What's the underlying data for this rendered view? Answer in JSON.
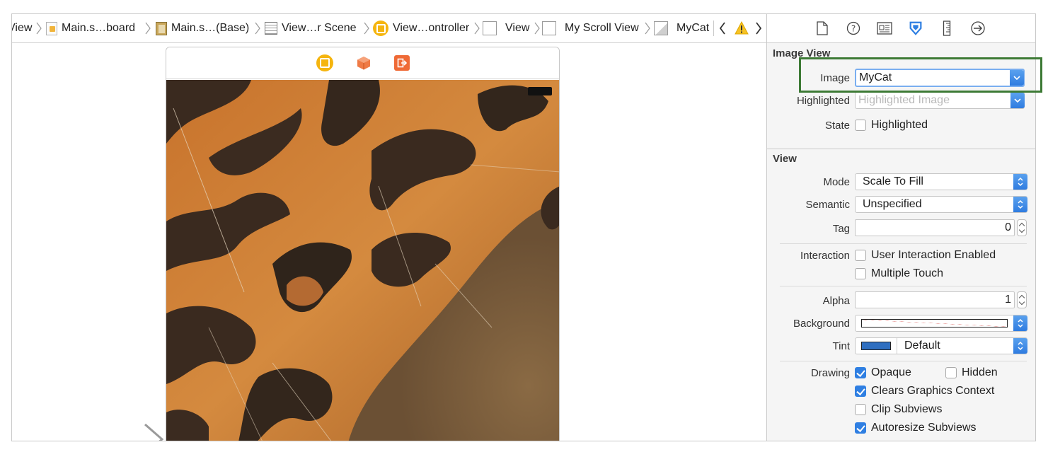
{
  "breadcrumbs": {
    "items": [
      {
        "label": "View",
        "icon": "none"
      },
      {
        "label": "Main.s…board",
        "icon": "storyboard-file-icon"
      },
      {
        "label": "Main.s…(Base)",
        "icon": "base-localization-icon"
      },
      {
        "label": "View…r Scene",
        "icon": "scene-icon"
      },
      {
        "label": "View…ontroller",
        "icon": "view-controller-icon"
      },
      {
        "label": "View",
        "icon": "view-icon"
      },
      {
        "label": "My Scroll View",
        "icon": "scroll-view-icon"
      },
      {
        "label": "MyCat",
        "icon": "image-view-icon"
      }
    ],
    "warning_icon": "warning-icon"
  },
  "inspector": {
    "tabs": [
      "file-inspector-icon",
      "quick-help-icon",
      "identity-inspector-icon",
      "attributes-inspector-icon",
      "size-inspector-icon",
      "connections-inspector-icon"
    ],
    "active_tab": "attributes-inspector-icon",
    "image_view": {
      "title": "Image View",
      "image_label": "Image",
      "image_value": "MyCat",
      "highlighted_label": "Highlighted",
      "highlighted_placeholder": "Highlighted Image",
      "state_label": "State",
      "state_checkbox_label": "Highlighted",
      "state_checked": false
    },
    "view": {
      "title": "View",
      "mode_label": "Mode",
      "mode_value": "Scale To Fill",
      "semantic_label": "Semantic",
      "semantic_value": "Unspecified",
      "tag_label": "Tag",
      "tag_value": "0",
      "interaction_label": "Interaction",
      "user_interaction_label": "User Interaction Enabled",
      "user_interaction_checked": false,
      "multiple_touch_label": "Multiple Touch",
      "multiple_touch_checked": false,
      "alpha_label": "Alpha",
      "alpha_value": "1",
      "background_label": "Background",
      "tint_label": "Tint",
      "tint_value": "Default",
      "tint_color": "#2f6fc0",
      "drawing_label": "Drawing",
      "opaque_label": "Opaque",
      "opaque_checked": true,
      "hidden_label": "Hidden",
      "hidden_checked": false,
      "clears_label": "Clears Graphics Context",
      "clears_checked": true,
      "clip_label": "Clip Subviews",
      "clip_checked": false,
      "autoresize_label": "Autoresize Subviews",
      "autoresize_checked": true
    }
  },
  "colors": {
    "accent": "#2f7fe2",
    "highlight_box": "#3d7a35",
    "vc_yellow": "#f5b50f",
    "first_responder_orange": "#ef6a36"
  }
}
